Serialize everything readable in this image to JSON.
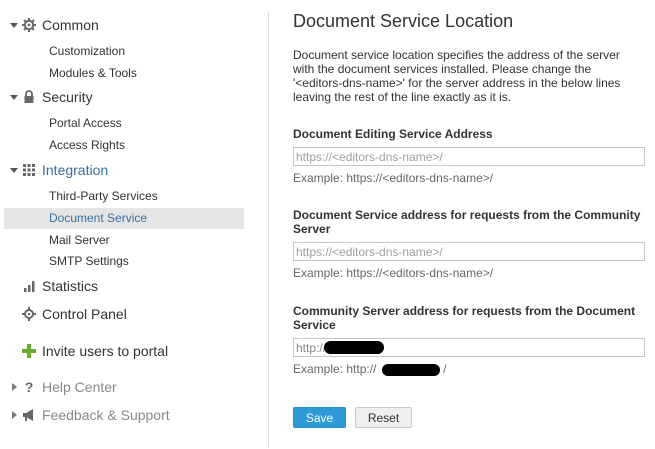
{
  "sidebar": {
    "groups": [
      {
        "label": "Common",
        "icon": "gear-icon",
        "items": [
          "Customization",
          "Modules & Tools"
        ]
      },
      {
        "label": "Security",
        "icon": "lock-icon",
        "items": [
          "Portal Access",
          "Access Rights"
        ]
      },
      {
        "label": "Integration",
        "icon": "grid-icon",
        "items": [
          "Third-Party Services",
          "Document Service",
          "Mail Server",
          "SMTP Settings"
        ]
      },
      {
        "label": "Statistics",
        "icon": "bar-chart-icon"
      },
      {
        "label": "Control Panel",
        "icon": "control-panel-icon"
      },
      {
        "label": "Invite users to portal",
        "icon": "plus-icon"
      },
      {
        "label": "Help Center",
        "icon": "question-icon"
      },
      {
        "label": "Feedback & Support",
        "icon": "megaphone-icon"
      }
    ],
    "active_item": "Document Service"
  },
  "main": {
    "title": "Document Service Location",
    "description": "Document service location specifies the address of the server with the document services installed. Please change the '<editors-dns-name>' for the server address in the below lines leaving the rest of the line exactly as it is.",
    "fields": [
      {
        "label": "Document Editing Service Address",
        "placeholder": "https://<editors-dns-name>/",
        "example": "Example: https://<editors-dns-name>/"
      },
      {
        "label": "Document Service address for requests from the Community Server",
        "placeholder": "https://<editors-dns-name>/",
        "example": "Example: https://<editors-dns-name>/"
      },
      {
        "label": "Community Server address for requests from the Document Service",
        "placeholder": "http://",
        "example": "Example: http://",
        "example_suffix": "/"
      }
    ],
    "save_label": "Save",
    "reset_label": "Reset"
  },
  "colors": {
    "accent_link": "#3a6f9e",
    "save_button": "#2e9bd6",
    "plus_green": "#6aab2e",
    "active_bg": "#e5e5e5"
  }
}
